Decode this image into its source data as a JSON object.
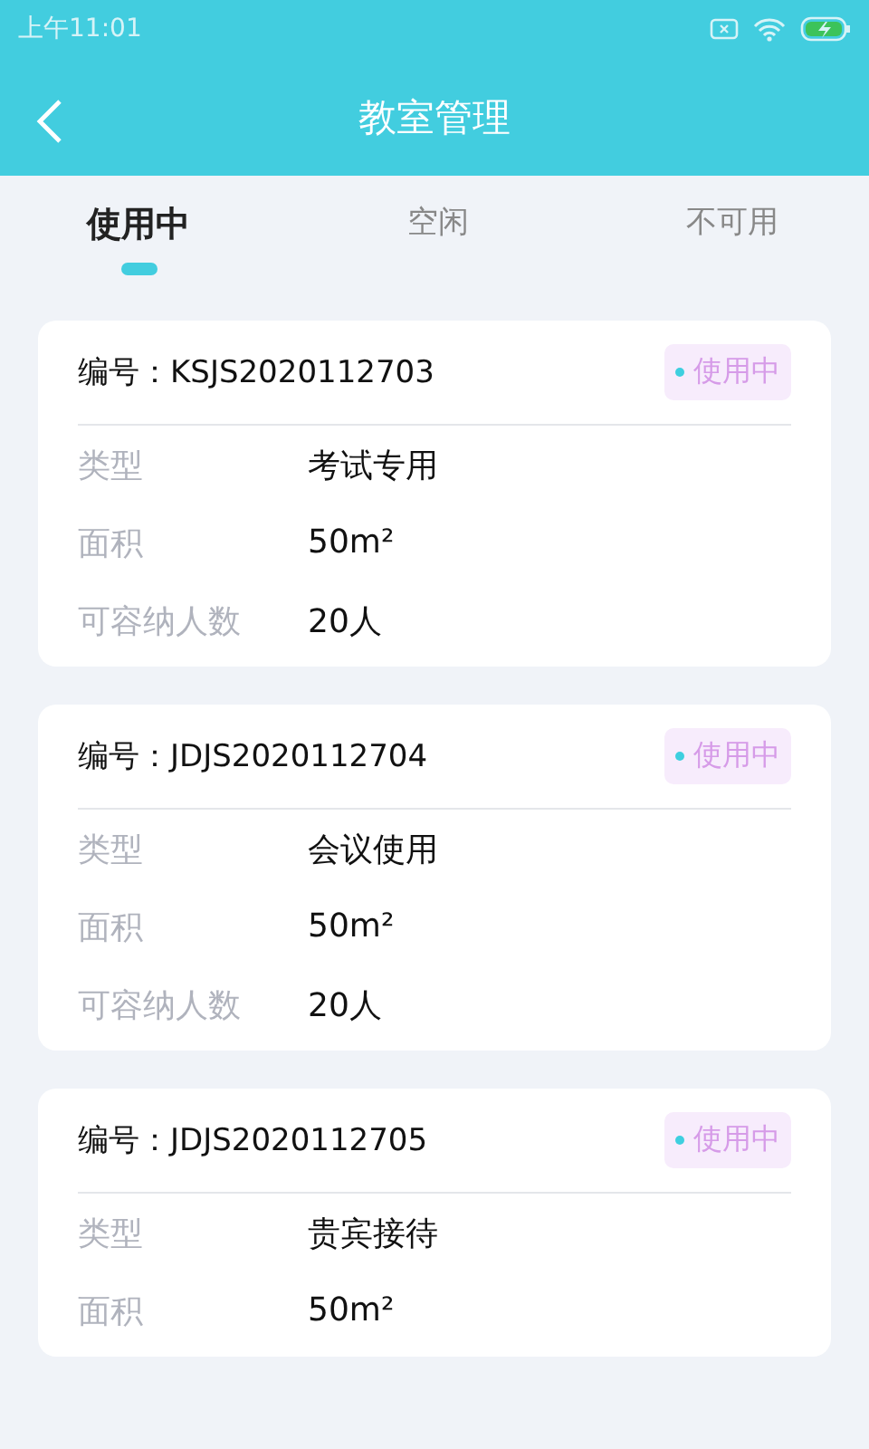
{
  "status_bar": {
    "time": "上午11:01"
  },
  "header": {
    "title": "教室管理"
  },
  "tabs": [
    {
      "label": "使用中",
      "selected": true
    },
    {
      "label": "空闲",
      "selected": false
    },
    {
      "label": "不可用",
      "selected": false
    }
  ],
  "rooms": [
    {
      "number": "编号：KSJS2020112703",
      "status": "使用中",
      "color": "#3ecfdf",
      "fields": [
        {
          "label": "类型",
          "value": "考试专用"
        },
        {
          "label": "面积",
          "value": "50m²"
        },
        {
          "label": "可容纳人数",
          "value": "20人"
        }
      ]
    },
    {
      "number": "编号：JDJS2020112704",
      "status": "使用中",
      "color": "#3ecfdf",
      "fields": [
        {
          "label": "类型",
          "value": "会议使用"
        },
        {
          "label": "面积",
          "value": "50m²"
        },
        {
          "label": "可容纳人数",
          "value": "20人"
        }
      ]
    },
    {
      "number": "编号：JDJS2020112705",
      "status": "使用中",
      "color": "#3ecfdf",
      "fields": [
        {
          "label": "类型",
          "value": "贵宾接待"
        },
        {
          "label": "面积",
          "value": "50m²"
        }
      ]
    }
  ]
}
